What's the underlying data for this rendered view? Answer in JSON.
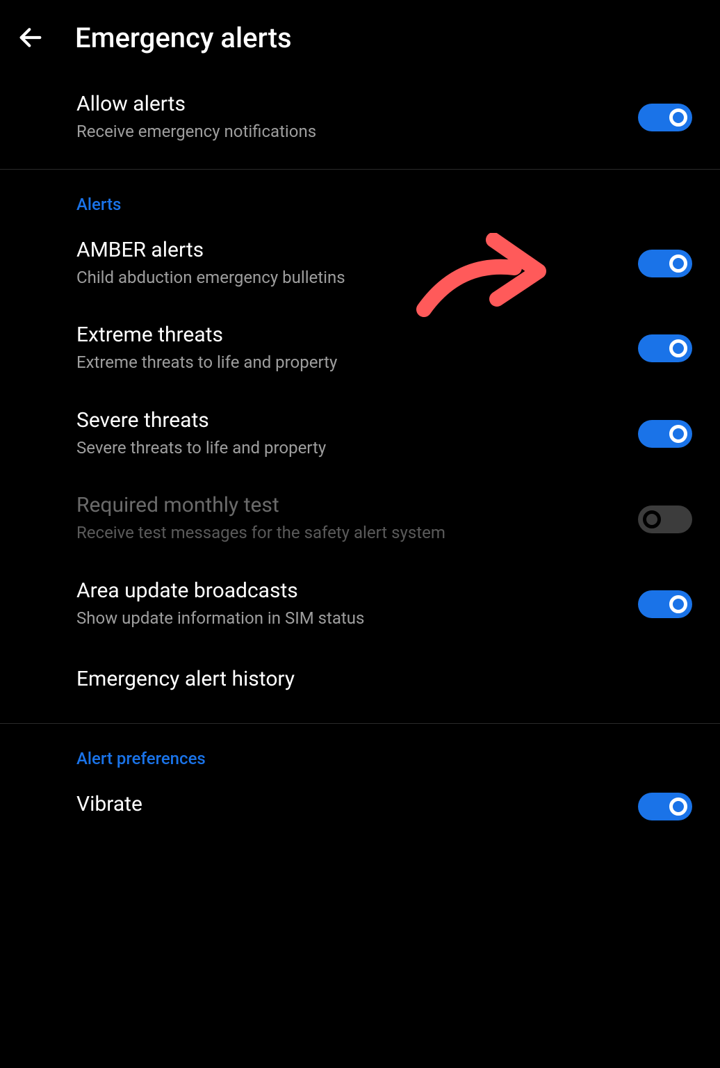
{
  "header": {
    "title": "Emergency alerts"
  },
  "allow_alerts": {
    "title": "Allow alerts",
    "subtitle": "Receive emergency notifications",
    "enabled": true
  },
  "sections": {
    "alerts": {
      "header": "Alerts",
      "items": [
        {
          "id": "amber",
          "title": "AMBER alerts",
          "subtitle": "Child abduction emergency bulletins",
          "toggle": "on",
          "disabled": false
        },
        {
          "id": "extreme",
          "title": "Extreme threats",
          "subtitle": "Extreme threats to life and property",
          "toggle": "on",
          "disabled": false
        },
        {
          "id": "severe",
          "title": "Severe threats",
          "subtitle": "Severe threats to life and property",
          "toggle": "on",
          "disabled": false
        },
        {
          "id": "monthly_test",
          "title": "Required monthly test",
          "subtitle": "Receive test messages for the safety alert system",
          "toggle": "off",
          "disabled": true
        },
        {
          "id": "area_broadcasts",
          "title": "Area update broadcasts",
          "subtitle": "Show update information in SIM status",
          "toggle": "on",
          "disabled": false
        },
        {
          "id": "history",
          "title": "Emergency alert history",
          "subtitle": null,
          "toggle": null,
          "disabled": false
        }
      ]
    },
    "preferences": {
      "header": "Alert preferences",
      "items": [
        {
          "id": "vibrate",
          "title": "Vibrate",
          "subtitle": null,
          "toggle": "on",
          "disabled": false
        }
      ]
    }
  },
  "annotation": {
    "type": "arrow",
    "color": "#ff5a5a",
    "target": "amber-alerts-toggle"
  }
}
